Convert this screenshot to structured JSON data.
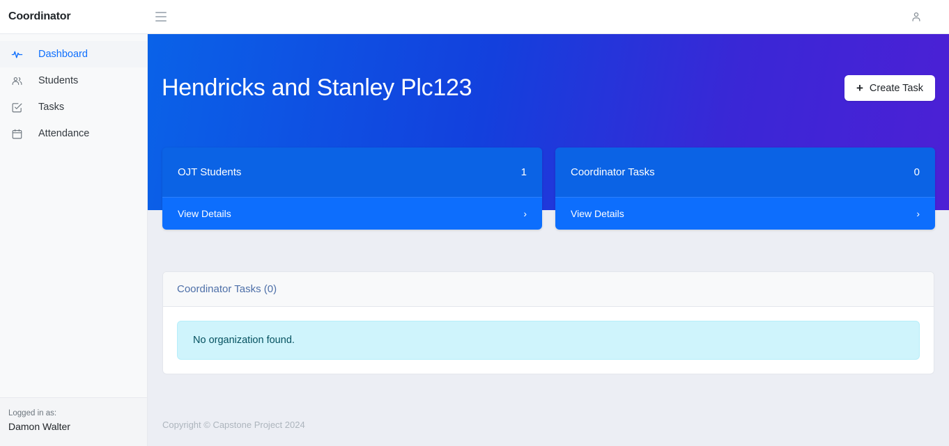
{
  "navbar": {
    "brand": "Coordinator",
    "menu_icon": "hamburger-icon",
    "user_icon": "user-icon"
  },
  "sidebar": {
    "items": [
      {
        "label": "Dashboard",
        "icon": "activity-pulse-icon",
        "active": true
      },
      {
        "label": "Students",
        "icon": "people-icon",
        "active": false
      },
      {
        "label": "Tasks",
        "icon": "checklist-square-icon",
        "active": false
      },
      {
        "label": "Attendance",
        "icon": "calendar-icon",
        "active": false
      }
    ],
    "footer": {
      "logged_in_label": "Logged in as:",
      "user_name": "Damon Walter"
    }
  },
  "hero": {
    "title": "Hendricks and Stanley Plc123",
    "create_task_label": "Create Task",
    "plus_icon": "plus-icon",
    "gradient_start": "#0a62e8",
    "gradient_end": "#4c20d5"
  },
  "cards": [
    {
      "label": "OJT Students",
      "value": "1",
      "footer_label": "View Details",
      "chevron_icon": "chevron-right-icon",
      "color": "#0d6efd"
    },
    {
      "label": "Coordinator Tasks",
      "value": "0",
      "footer_label": "View Details",
      "chevron_icon": "chevron-right-icon",
      "color": "#0d6efd"
    }
  ],
  "panel": {
    "header": "Coordinator Tasks (0)",
    "alert_text": "No organization found.",
    "alert_color": "#cff4fc"
  },
  "footer": {
    "copyright": "Copyright © Capstone Project 2024"
  }
}
